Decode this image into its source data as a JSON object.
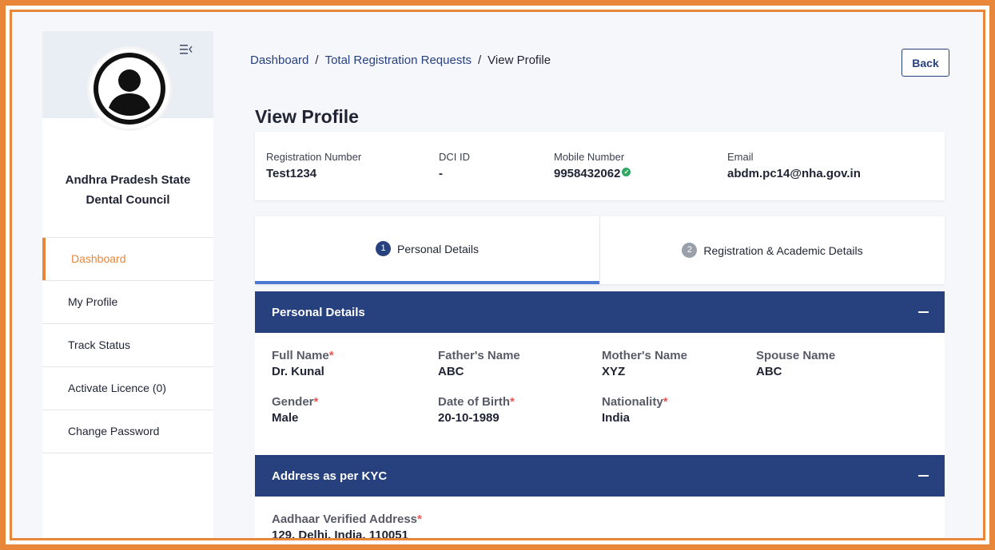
{
  "sidebar": {
    "org_name_line1": "Andhra Pradesh State",
    "org_name_line2": "Dental Council",
    "menu_icon": "menu-collapse-icon",
    "nav": [
      {
        "label": "Dashboard",
        "active": true
      },
      {
        "label": "My Profile",
        "active": false
      },
      {
        "label": "Track Status",
        "active": false
      },
      {
        "label": "Activate Licence (0)",
        "active": false
      },
      {
        "label": "Change Password",
        "active": false
      }
    ]
  },
  "breadcrumb": {
    "items": [
      "Dashboard",
      "Total Registration Requests",
      "View Profile"
    ],
    "separator": "/"
  },
  "back_button": "Back",
  "page_title": "View Profile",
  "summary": {
    "registration_number": {
      "label": "Registration Number",
      "value": "Test1234"
    },
    "dci_id": {
      "label": "DCI ID",
      "value": "-"
    },
    "mobile_number": {
      "label": "Mobile Number",
      "value": "9958432062",
      "verified": true
    },
    "email": {
      "label": "Email",
      "value": "abdm.pc14@nha.gov.in"
    }
  },
  "tabs": [
    {
      "step": "1",
      "label": "Personal Details",
      "active": true
    },
    {
      "step": "2",
      "label": "Registration & Academic Details",
      "active": false
    }
  ],
  "personal_details": {
    "title": "Personal Details",
    "fields": {
      "full_name": {
        "label": "Full Name",
        "required": "*",
        "value": "Dr. Kunal"
      },
      "fathers_name": {
        "label": "Father's Name",
        "value": "ABC"
      },
      "mothers_name": {
        "label": "Mother's Name",
        "value": "XYZ"
      },
      "spouse_name": {
        "label": "Spouse Name",
        "value": "ABC"
      },
      "gender": {
        "label": "Gender",
        "required": "*",
        "value": "Male"
      },
      "date_of_birth": {
        "label": "Date of Birth",
        "required": "*",
        "value": "20-10-1989"
      },
      "nationality": {
        "label": "Nationality",
        "required": "*",
        "value": "India"
      }
    }
  },
  "address": {
    "title": "Address as per KYC",
    "aadhaar_label": "Aadhaar Verified Address",
    "required": "*",
    "aadhaar_value": "129, Delhi, India, 110051"
  },
  "colors": {
    "accent_orange": "#e8863a",
    "primary_navy": "#27407e",
    "tab_underline": "#4a78d4",
    "verified_green": "#2ea862",
    "required_red": "#e53935"
  }
}
